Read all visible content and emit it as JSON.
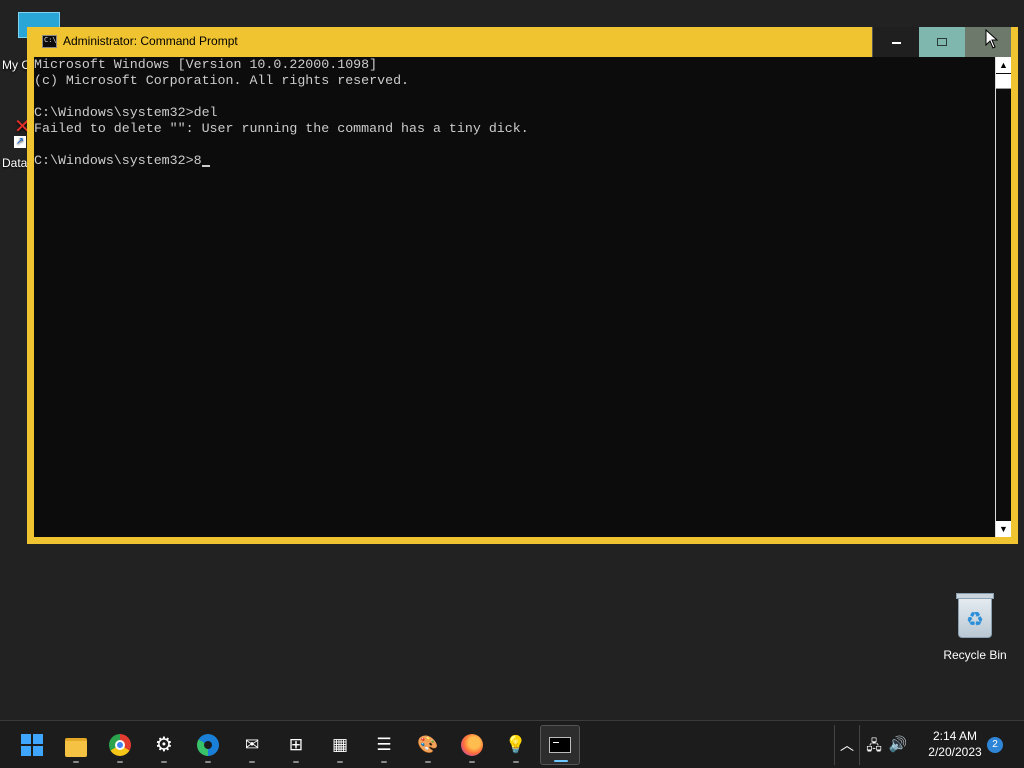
{
  "desktop": {
    "icons": [
      {
        "label": "My C"
      },
      {
        "label": "Data"
      }
    ],
    "recycle_bin": {
      "label": "Recycle Bin"
    }
  },
  "window": {
    "title": "Administrator:  Command Prompt",
    "app_icon_text": "C:\\",
    "console_lines": [
      "Microsoft Windows [Version 10.0.22000.1098]",
      "(c) Microsoft Corporation. All rights reserved.",
      "",
      "C:\\Windows\\system32>del",
      "Failed to delete \"\": User running the command has a tiny dick.",
      "",
      "C:\\Windows\\system32>8"
    ],
    "colors": {
      "frame": "#f0c430",
      "console_bg": "#0c0c0c",
      "console_fg": "#cccccc"
    }
  },
  "taskbar": {
    "apps": [
      {
        "name": "start",
        "icon": "windows-logo-icon"
      },
      {
        "name": "file-explorer",
        "icon": "folder-icon"
      },
      {
        "name": "chrome",
        "icon": "chrome-icon"
      },
      {
        "name": "settings",
        "icon": "gear-icon"
      },
      {
        "name": "edge",
        "icon": "edge-icon"
      },
      {
        "name": "mail",
        "icon": "mail-icon"
      },
      {
        "name": "store",
        "icon": "store-icon"
      },
      {
        "name": "calculator",
        "icon": "calculator-icon"
      },
      {
        "name": "notepad",
        "icon": "notepad-icon"
      },
      {
        "name": "paint",
        "icon": "palette-icon"
      },
      {
        "name": "firefox",
        "icon": "firefox-icon"
      },
      {
        "name": "tips",
        "icon": "lightbulb-icon"
      },
      {
        "name": "command-prompt",
        "icon": "terminal-icon"
      }
    ],
    "clock": {
      "time": "2:14 AM",
      "date": "2/20/2023"
    },
    "notification_count": "2"
  }
}
